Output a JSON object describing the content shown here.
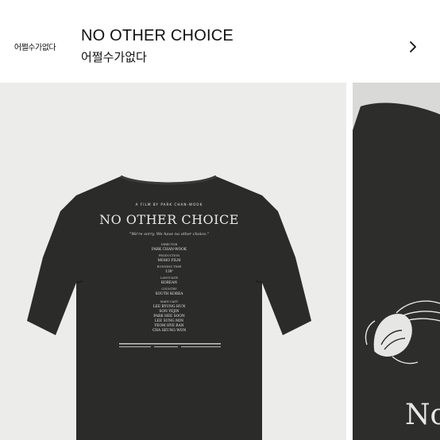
{
  "header": {
    "thumb_label": "어쩔수가없다",
    "title_en": "NO OTHER CHOICE",
    "title_ko": "어쩔수가없다"
  },
  "shirt": {
    "film_line": "A FILM BY PARK CHAN-WOOK",
    "title": "NO OTHER CHOICE",
    "tagline": "\"We're sorry. We have no other choice.\"",
    "credits": [
      {
        "role": "DIRECTOR",
        "value": "PARK CHAN-WOOK"
      },
      {
        "role": "PRODUCTION",
        "value": "MOHO FILM"
      },
      {
        "role": "RUNNING TIME",
        "value": "139'"
      },
      {
        "role": "LANGUAGE",
        "value": "KOREAN"
      },
      {
        "role": "COUNTRY",
        "value": "SOUTH KOREA"
      }
    ],
    "cast_label": "MAIN CAST",
    "cast": [
      "LEE BYUNG HUN",
      "SON YEJIN",
      "PARK HEE SOON",
      "LEE SUNG MIN",
      "YEOM HYE RAN",
      "CHA SEUNG WON"
    ],
    "closeup_text": "No"
  },
  "colors": {
    "shirt": "#2b2b2a",
    "print": "#e8e8e6",
    "slide_bg": "#ececea"
  }
}
